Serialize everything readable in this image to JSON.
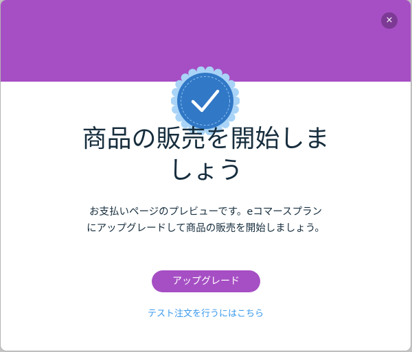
{
  "colors": {
    "brand_purple": "#a64fc4",
    "close_bg": "#7d3a95",
    "badge_blue": "#3178c6",
    "badge_ring": "#a9d4f7",
    "link_blue": "#3899ec",
    "text_dark": "#162d3d"
  },
  "modal": {
    "close_icon": "close-icon",
    "close_glyph": "×",
    "badge_icon": "checkmark-badge-icon",
    "title_lines": [
      "商品の販売を開始しま",
      "しょう"
    ],
    "description_lines": [
      "お支払いページのプレビューです。eコマースプラン",
      "にアップグレードして商品の販売を開始しましょう。"
    ],
    "upgrade_label": "アップグレード",
    "test_order_link": "テスト注文を行うにはこちら"
  }
}
